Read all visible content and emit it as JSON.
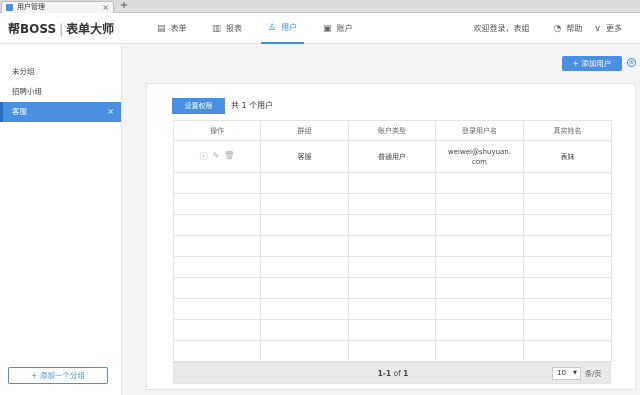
{
  "browser": {
    "tab_title": "用户管理",
    "close_glyph": "×",
    "new_tab_glyph": "+"
  },
  "header": {
    "logo_brand": "帮BOSS",
    "logo_sep": "|",
    "logo_product": "表单大师",
    "nav": [
      {
        "label": "表单",
        "icon": "form-icon",
        "glyph": "▤"
      },
      {
        "label": "报表",
        "icon": "chart-icon",
        "glyph": "▥"
      },
      {
        "label": "用户",
        "icon": "user-icon",
        "glyph": "♙"
      },
      {
        "label": "账户",
        "icon": "wallet-icon",
        "glyph": "▣"
      }
    ],
    "active_nav": "用户",
    "welcome": "欢迎登录，表姐",
    "help_label": "帮助",
    "help_glyph": "◔",
    "more_label": "更多",
    "more_glyph": "∨"
  },
  "sidebar": {
    "groups": [
      {
        "label": "未分组"
      },
      {
        "label": "招聘小组"
      },
      {
        "label": "客服"
      }
    ],
    "active_index": 2,
    "remove_glyph": "×",
    "add_group_label": "+ 添加一个分组"
  },
  "main": {
    "add_user_label": "+ 添加用户",
    "collapse_glyph": "⊗",
    "permission_button": "设置权限",
    "count_text": "共 1 个用户",
    "columns": [
      "操作",
      "群组",
      "账户类型",
      "登录用户名",
      "真实姓名"
    ],
    "rows": [
      {
        "ops": [
          {
            "icon": "info-icon",
            "glyph": "ⓘ"
          },
          {
            "icon": "edit-icon",
            "glyph": "✎"
          },
          {
            "icon": "delete-icon",
            "glyph": "🗑"
          }
        ],
        "group": "客服",
        "account_type": "普通用户",
        "username": "weiwei@shuyuan.com",
        "real_name": "表妹"
      }
    ],
    "pagination": {
      "range": "1-1",
      "of_word": "of",
      "total": "1",
      "page_size": "10",
      "per_page_label": "条/页",
      "caret": "▼"
    }
  },
  "colors": {
    "accent": "#4a90e2",
    "nav_active": "#3a8ee6"
  }
}
